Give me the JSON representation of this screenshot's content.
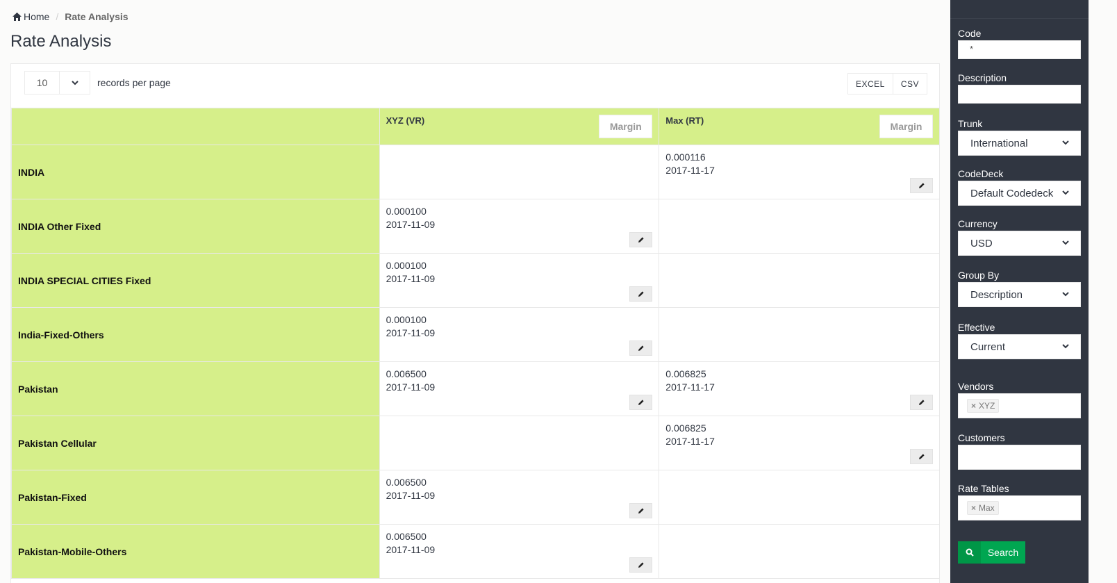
{
  "breadcrumb": {
    "home": "Home",
    "current": "Rate Analysis"
  },
  "page_title": "Rate Analysis",
  "table_controls": {
    "per_page": "10",
    "per_page_label": "records per page",
    "excel": "EXCEL",
    "csv": "CSV"
  },
  "columns": [
    {
      "name": "XYZ (VR)",
      "margin": "Margin"
    },
    {
      "name": "Max (RT)",
      "margin": "Margin"
    }
  ],
  "rows": [
    {
      "dest": "INDIA",
      "c1": {
        "rate": "",
        "date": ""
      },
      "c2": {
        "rate": "0.000116",
        "date": "2017-11-17"
      }
    },
    {
      "dest": "INDIA Other Fixed",
      "c1": {
        "rate": "0.000100",
        "date": "2017-11-09"
      },
      "c2": {
        "rate": "",
        "date": ""
      }
    },
    {
      "dest": "INDIA SPECIAL CITIES Fixed",
      "c1": {
        "rate": "0.000100",
        "date": "2017-11-09"
      },
      "c2": {
        "rate": "",
        "date": ""
      }
    },
    {
      "dest": "India-Fixed-Others",
      "c1": {
        "rate": "0.000100",
        "date": "2017-11-09"
      },
      "c2": {
        "rate": "",
        "date": ""
      }
    },
    {
      "dest": "Pakistan",
      "c1": {
        "rate": "0.006500",
        "date": "2017-11-09"
      },
      "c2": {
        "rate": "0.006825",
        "date": "2017-11-17"
      }
    },
    {
      "dest": "Pakistan Cellular",
      "c1": {
        "rate": "",
        "date": ""
      },
      "c2": {
        "rate": "0.006825",
        "date": "2017-11-17"
      }
    },
    {
      "dest": "Pakistan-Fixed",
      "c1": {
        "rate": "0.006500",
        "date": "2017-11-09"
      },
      "c2": {
        "rate": "",
        "date": ""
      }
    },
    {
      "dest": "Pakistan-Mobile-Others",
      "c1": {
        "rate": "0.006500",
        "date": "2017-11-09"
      },
      "c2": {
        "rate": "",
        "date": ""
      }
    }
  ],
  "filters": {
    "code": {
      "label": "Code",
      "value": "*"
    },
    "description": {
      "label": "Description",
      "value": ""
    },
    "trunk": {
      "label": "Trunk",
      "value": "International"
    },
    "codedeck": {
      "label": "CodeDeck",
      "value": "Default Codedeck"
    },
    "currency": {
      "label": "Currency",
      "value": "USD"
    },
    "group_by": {
      "label": "Group By",
      "value": "Description"
    },
    "effective": {
      "label": "Effective",
      "value": "Current"
    },
    "vendors": {
      "label": "Vendors",
      "tags": [
        "XYZ"
      ]
    },
    "customers": {
      "label": "Customers",
      "tags": []
    },
    "rate_tables": {
      "label": "Rate Tables",
      "tags": [
        "Max"
      ]
    },
    "search_label": "Search"
  },
  "icons": {
    "home": "home-icon",
    "edit": "pencil-icon",
    "chevron": "chevron-down-icon",
    "search": "search-icon",
    "remove": "x-icon"
  }
}
